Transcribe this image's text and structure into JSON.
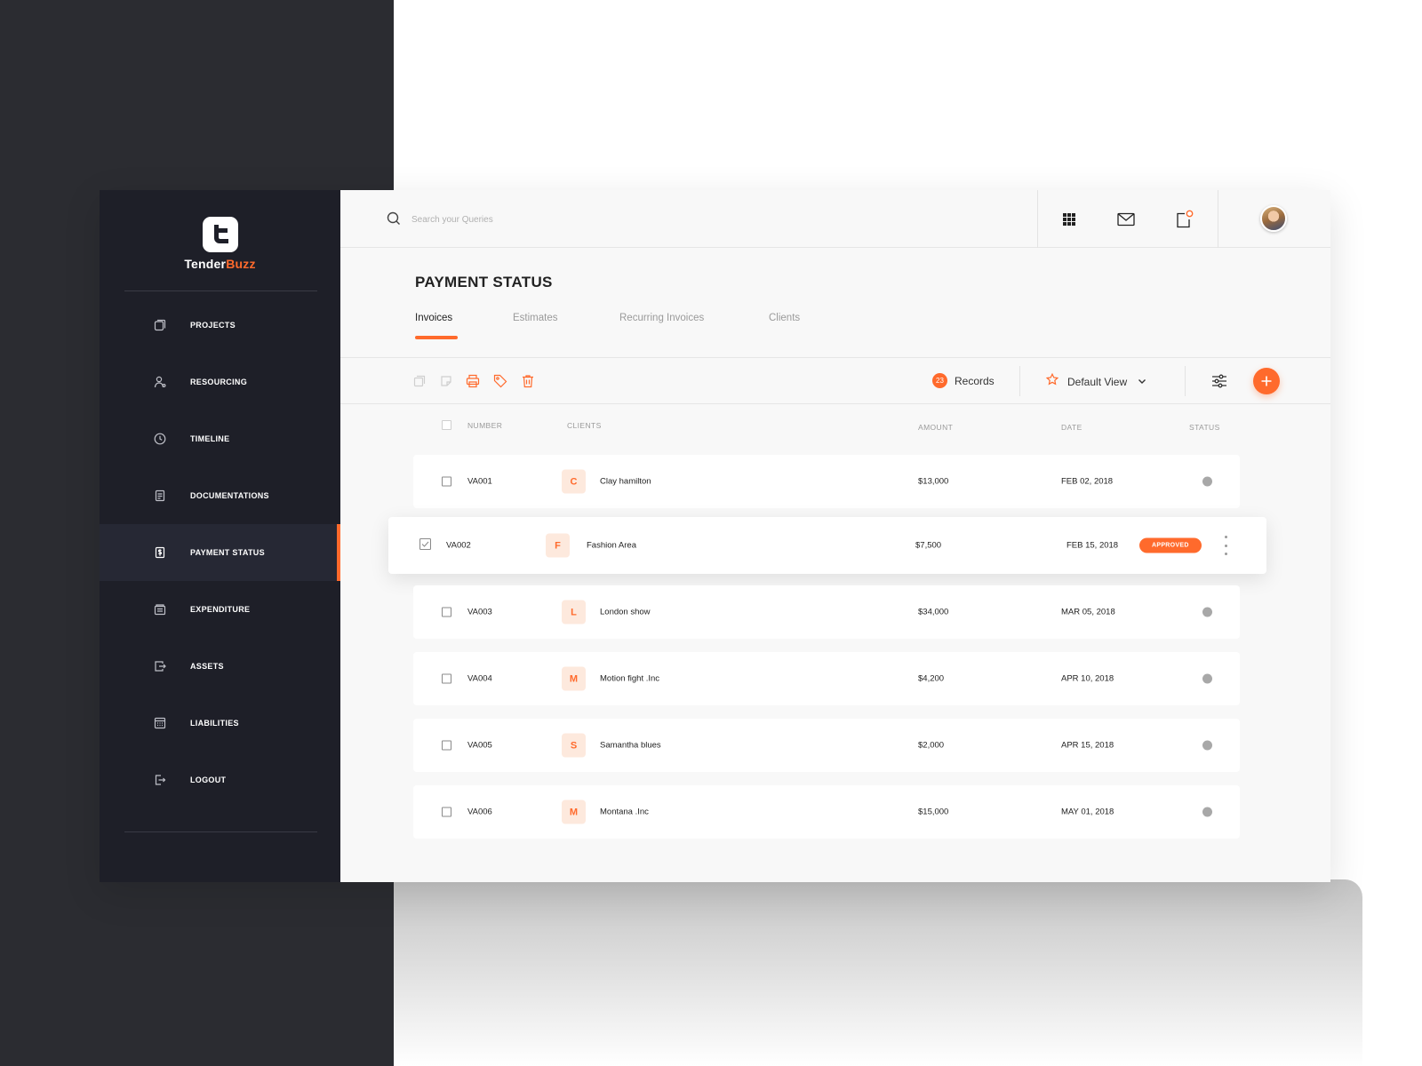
{
  "app": {
    "name_main": "Tender",
    "name_accent": "Buzz"
  },
  "sidebar": {
    "items": [
      {
        "label": "PROJECTS",
        "icon": "projects-icon"
      },
      {
        "label": "RESOURCING",
        "icon": "user-icon"
      },
      {
        "label": "TIMELINE",
        "icon": "clock-icon"
      },
      {
        "label": "DOCUMENTATIONS",
        "icon": "document-icon"
      },
      {
        "label": "PAYMENT STATUS",
        "icon": "dollar-icon",
        "active": true
      },
      {
        "label": "EXPENDITURE",
        "icon": "wallet-icon"
      },
      {
        "label": "ASSETS",
        "icon": "assets-icon"
      },
      {
        "label": "LIABILITIES",
        "icon": "calculator-icon"
      },
      {
        "label": "LOGOUT",
        "icon": "logout-icon"
      }
    ]
  },
  "header": {
    "search_placeholder": "Search your Queries"
  },
  "page": {
    "title": "PAYMENT STATUS",
    "tabs": [
      {
        "label": "Invoices",
        "active": true
      },
      {
        "label": "Estimates"
      },
      {
        "label": "Recurring Invoices"
      },
      {
        "label": "Clients"
      }
    ]
  },
  "toolbar": {
    "records_count": "23",
    "records_label": "Records",
    "view_label": "Default View"
  },
  "table": {
    "columns": {
      "number": "NUMBER",
      "clients": "CLIENTS",
      "amount": "AMOUNT",
      "date": "DATE",
      "status": "STATUS"
    },
    "rows": [
      {
        "number": "VA001",
        "initial": "C",
        "client": "Clay hamilton",
        "amount": "$13,000",
        "date": "FEB 02, 2018",
        "status": ""
      },
      {
        "number": "VA002",
        "initial": "F",
        "client": "Fashion Area",
        "amount": "$7,500",
        "date": "FEB 15, 2018",
        "status": "APPROVED",
        "selected": true
      },
      {
        "number": "VA003",
        "initial": "L",
        "client": "London show",
        "amount": "$34,000",
        "date": "MAR 05, 2018",
        "status": ""
      },
      {
        "number": "VA004",
        "initial": "M",
        "client": "Motion fight .Inc",
        "amount": "$4,200",
        "date": "APR 10, 2018",
        "status": ""
      },
      {
        "number": "VA005",
        "initial": "S",
        "client": "Samantha blues",
        "amount": "$2,000",
        "date": "APR 15, 2018",
        "status": ""
      },
      {
        "number": "VA006",
        "initial": "M",
        "client": "Montana .Inc",
        "amount": "$15,000",
        "date": "MAY 01, 2018",
        "status": ""
      }
    ]
  },
  "colors": {
    "accent": "#ff6a2c",
    "sidebar": "#1e1f28",
    "sidebar_active": "#262834"
  }
}
